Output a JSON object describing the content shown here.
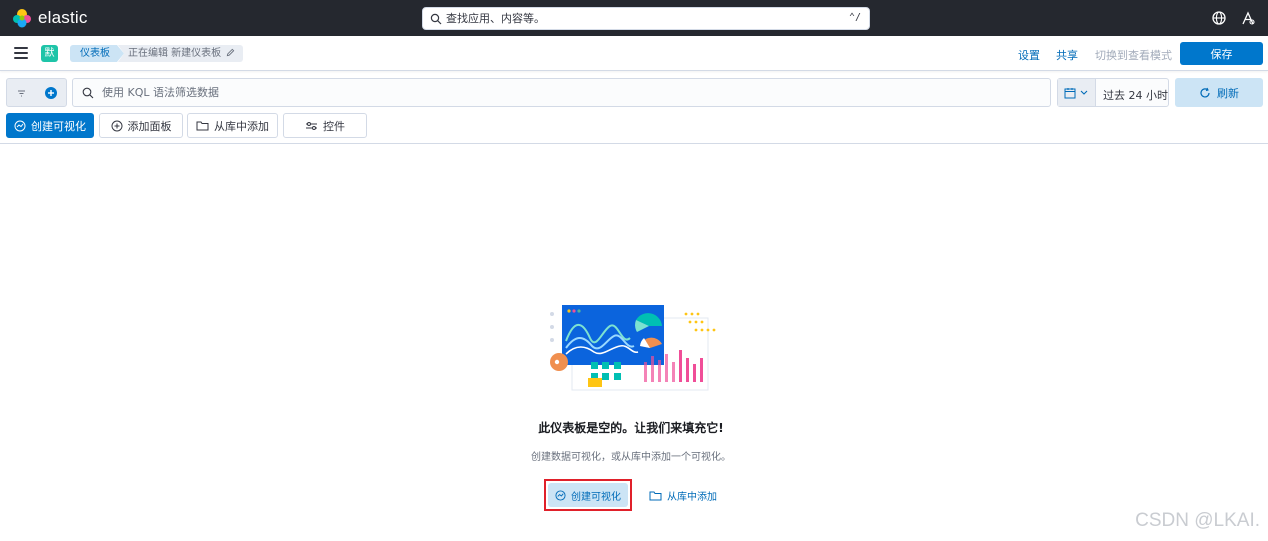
{
  "brand": {
    "name": "elastic"
  },
  "global_search": {
    "placeholder": "查找应用、内容等。",
    "shortcut": "⌃/"
  },
  "icons": {
    "help": "help-globe-icon",
    "user": "user-menu-icon",
    "menu": "hamburger-icon",
    "filter": "filter-icon",
    "add_filter": "plus-circle-icon",
    "search": "search-icon",
    "calendar": "calendar-icon",
    "refresh": "refresh-icon",
    "visualize": "visualize-icon",
    "add_panel": "plus-icon",
    "folder": "folder-icon",
    "controls": "controls-icon",
    "pencil": "pencil-icon"
  },
  "header": {
    "space_initial": "默",
    "breadcrumbs": [
      {
        "label": "仪表板"
      },
      {
        "label": "正在编辑 新建仪表板"
      }
    ],
    "settings_label": "设置",
    "share_label": "共享",
    "view_mode_label": "切换到查看模式",
    "save_label": "保存"
  },
  "query_bar": {
    "placeholder": "使用 KQL 语法筛选数据",
    "date_range": "过去 24 小时",
    "refresh_label": "刷新"
  },
  "toolbar": {
    "create_visualization": "创建可视化",
    "add_panel": "添加面板",
    "add_from_library": "从库中添加",
    "controls": "控件"
  },
  "empty_state": {
    "title": "此仪表板是空的。让我们来填充它!",
    "subtitle": "创建数据可视化，或从库中添加一个可视化。",
    "create_button": "创建可视化",
    "library_link": "从库中添加"
  },
  "watermark": "CSDN @LKAI.",
  "colors": {
    "topbar": "#25282f",
    "primary": "#0077cc",
    "primary_light": "#cce4f5",
    "link": "#006bb8",
    "highlight_border": "#e0202a"
  }
}
